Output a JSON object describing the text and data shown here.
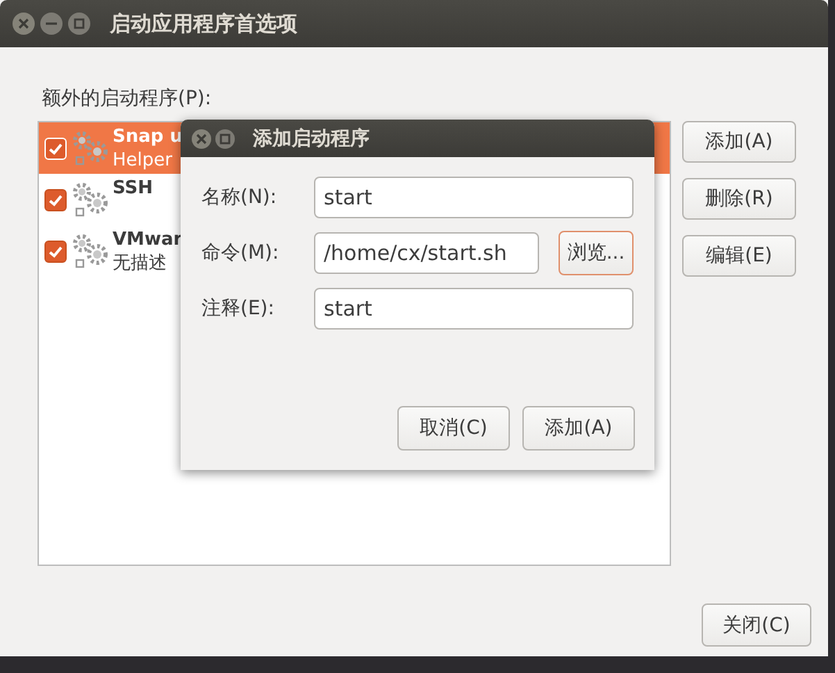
{
  "window": {
    "title": "启动应用程序首选项"
  },
  "list_label": "额外的启动程序(P):",
  "startup_programs": [
    {
      "name": "Snap u",
      "description": "Helper",
      "checked": true,
      "selected": true
    },
    {
      "name": "SSH",
      "checked": true,
      "selected": false
    },
    {
      "name": "VMwar",
      "description": "无描述",
      "checked": true,
      "selected": false
    }
  ],
  "side_buttons": [
    "添加(A)",
    "删除(R)",
    "编辑(E)"
  ],
  "close_button": "关闭(C)",
  "dialog": {
    "title": "添加启动程序",
    "fields": [
      {
        "label": "名称(N):",
        "value": "start"
      },
      {
        "label": "命令(M):",
        "value": "/home/cx/start.sh",
        "browse": "浏览..."
      },
      {
        "label": "注释(E):",
        "value": "start"
      }
    ],
    "buttons": [
      "取消(C)",
      "添加(A)"
    ]
  }
}
